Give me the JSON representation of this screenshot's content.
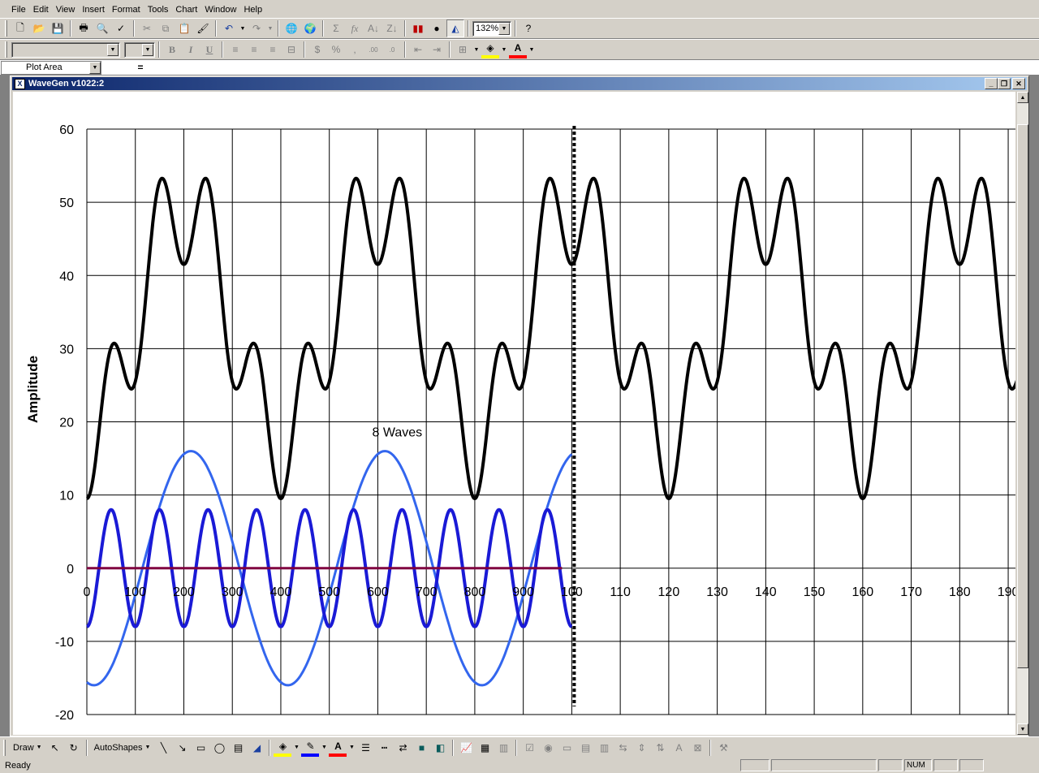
{
  "menu": [
    "File",
    "Edit",
    "View",
    "Insert",
    "Format",
    "Tools",
    "Chart",
    "Window",
    "Help"
  ],
  "toolbar": {
    "zoom": "132%"
  },
  "namebox": {
    "value": "Plot Area",
    "equals": "="
  },
  "window": {
    "title": "WaveGen v1022:2",
    "icon": "excel-icon"
  },
  "chart_data": {
    "type": "line",
    "ylabel": "Amplitude",
    "xlabel": "",
    "ylim": [
      -20,
      60
    ],
    "yticks": [
      -20,
      -10,
      0,
      10,
      20,
      30,
      40,
      50,
      60
    ],
    "xlim": [
      0,
      1920
    ],
    "xtick_labels": [
      "0",
      "100",
      "200",
      "300",
      "400",
      "500",
      "600",
      "700",
      "800",
      "900",
      "100",
      "110",
      "120",
      "130",
      "140",
      "150",
      "160",
      "170",
      "180",
      "190"
    ],
    "xtick_values": [
      0,
      100,
      200,
      300,
      400,
      500,
      600,
      700,
      800,
      900,
      1000,
      1100,
      1200,
      1300,
      1400,
      1500,
      1600,
      1700,
      1800,
      1900
    ],
    "grid": true,
    "annotation": {
      "text": "8 Waves",
      "x": 640,
      "y": 18
    },
    "vline": {
      "x": 1005,
      "style": "dotted"
    },
    "series": [
      {
        "color": "#000000",
        "width": 4,
        "x_range": [
          0,
          1920
        ],
        "period": 800,
        "components": [
          {
            "amp": 8,
            "period": 100,
            "phase": -1.5708
          },
          {
            "amp": 16,
            "period": 400,
            "phase": -1.5708
          }
        ],
        "offset": 33.5
      },
      {
        "color": "#3366ee",
        "width": 3,
        "x_range": [
          0,
          1000
        ],
        "components": [
          {
            "amp": 16,
            "period": 400,
            "phase": -1.8
          }
        ],
        "offset": 0
      },
      {
        "color": "#1a1ad6",
        "width": 4,
        "x_range": [
          0,
          1000
        ],
        "components": [
          {
            "amp": 8,
            "period": 100,
            "phase": -1.5708
          }
        ],
        "offset": 0
      },
      {
        "color": "#800040",
        "width": 3,
        "x_range": [
          0,
          980
        ],
        "components": [],
        "offset": 0
      }
    ],
    "colors": {
      "grid": "#000000",
      "axis": "#000000"
    }
  },
  "drawbar": {
    "draw": "Draw",
    "autoshapes": "AutoShapes"
  },
  "status": {
    "text": "Ready",
    "num": "NUM"
  }
}
